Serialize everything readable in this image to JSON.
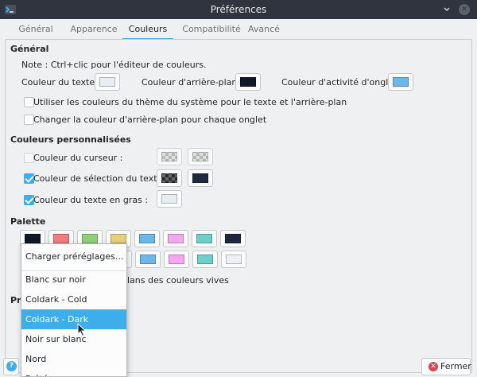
{
  "window": {
    "title": "Préférences"
  },
  "tabs": [
    {
      "label": "Général"
    },
    {
      "label": "Apparence"
    },
    {
      "label": "Couleurs"
    },
    {
      "label": "Compatibilité"
    },
    {
      "label": "Avancé"
    }
  ],
  "active_tab": "Couleurs",
  "general": {
    "heading": "Général",
    "note": "Note : Ctrl+clic pour l'éditeur de couleurs.",
    "text_color_label": "Couleur du texte :",
    "text_color": "#e8ecf3",
    "bg_color_label": "Couleur d'arrière-plan :",
    "bg_color": "#111827",
    "tab_activity_label": "Couleur d'activité d'onglet :",
    "tab_activity_color": "#6cb6e8",
    "use_system_colors_label": "Utiliser les couleurs du thème du système pour le texte et l'arrière-plan",
    "use_system_colors_checked": false,
    "change_bg_per_tab_label": "Changer la couleur d'arrière-plan pour chaque onglet",
    "change_bg_per_tab_checked": false
  },
  "custom": {
    "heading": "Couleurs personnalisées",
    "cursor_label": "Couleur du curseur :",
    "cursor_checked": false,
    "selection_label": "Couleur de sélection du texte :",
    "selection_checked": true,
    "selection_color": "#1e293b",
    "bold_label": "Couleur du texte en gras :",
    "bold_checked": true,
    "bold_color": "#e8ecf3"
  },
  "palette": {
    "heading": "Palette",
    "row1": [
      "#111827",
      "#f47c7c",
      "#8fd17a",
      "#e8cf7a",
      "#6cb6e8",
      "#f4a7f0",
      "#6ccfca",
      "#1e293b"
    ],
    "row2": [
      "#e8cf7a",
      "#6cb6e8",
      "#f4a7f0",
      "#6ccfca",
      "#eef1f4"
    ],
    "bright_label_partial": "lans des couleurs vives",
    "presets_heading_partial": "Pr"
  },
  "dropdown": {
    "items": [
      {
        "label": "Charger préréglages..."
      },
      {
        "label": "Blanc sur noir"
      },
      {
        "label": "Coldark - Cold"
      },
      {
        "label": "Coldark - Dark",
        "selected": true
      },
      {
        "label": "Noir sur blanc"
      },
      {
        "label": "Nord"
      },
      {
        "label": "Prété…"
      }
    ]
  },
  "buttons": {
    "close_label": "Fermer"
  },
  "colors": {
    "accent": "#3daee9",
    "titlebar": "#2f343f"
  }
}
